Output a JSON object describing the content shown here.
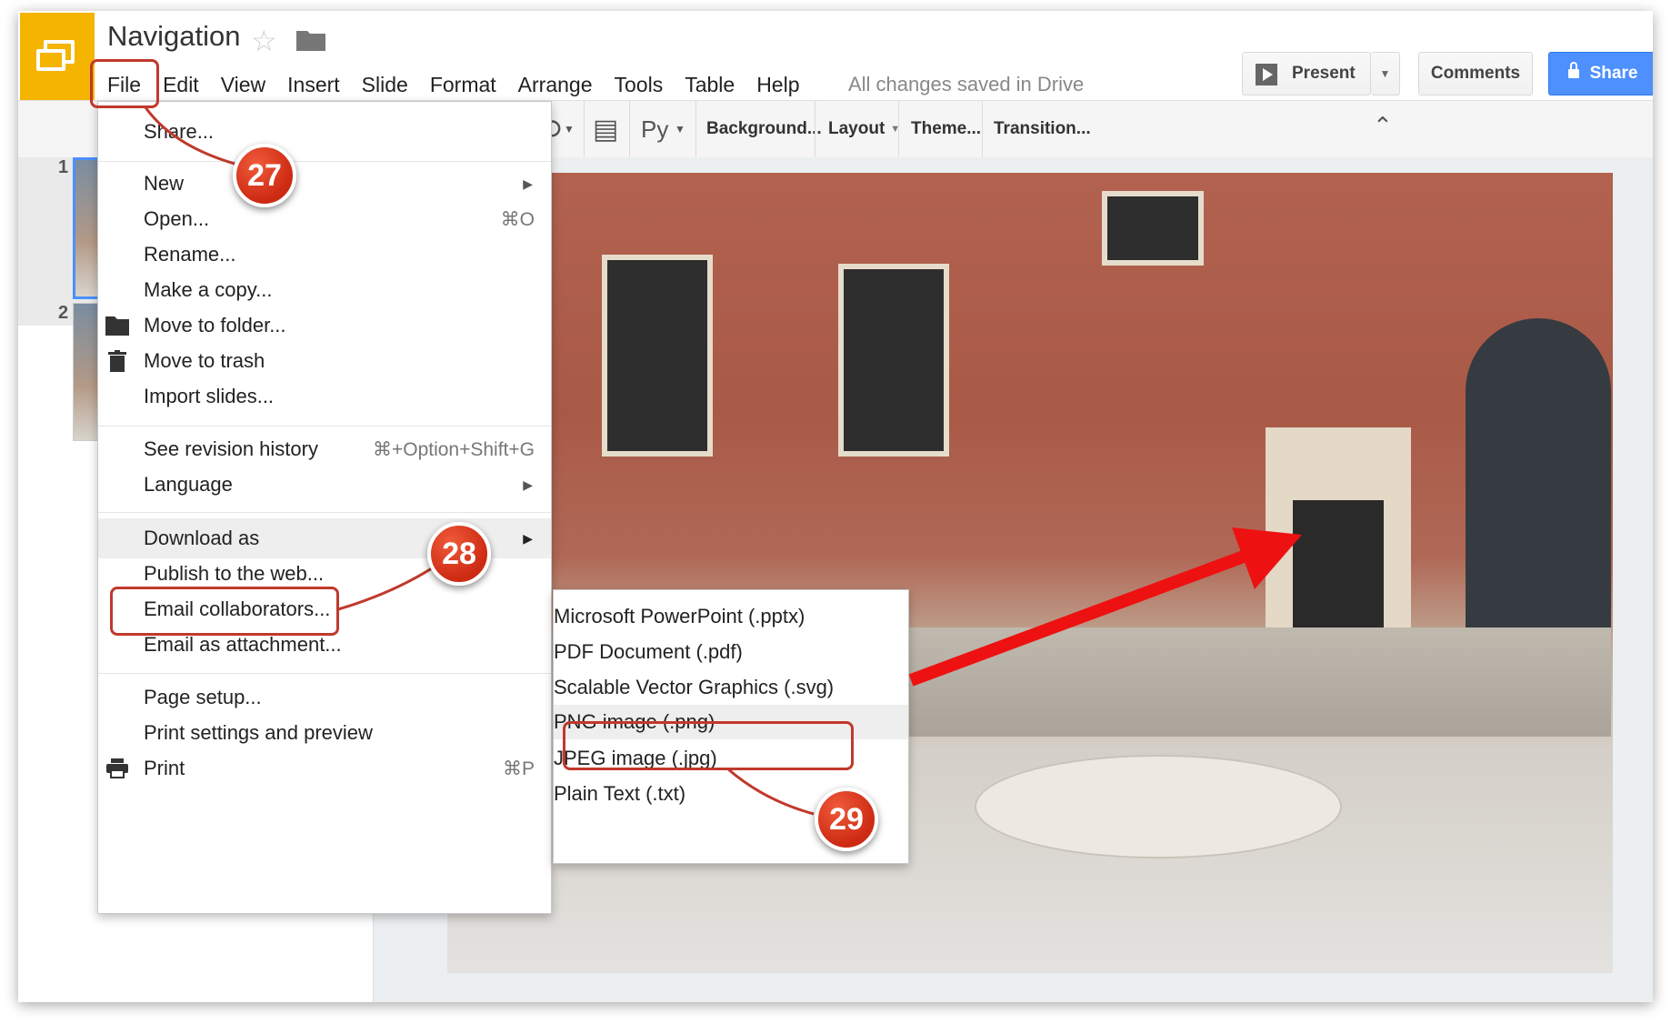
{
  "header": {
    "title": "Navigation",
    "save_status": "All changes saved in Drive",
    "present_label": "Present",
    "comments_label": "Comments",
    "share_label": "Share"
  },
  "menubar": [
    "File",
    "Edit",
    "View",
    "Insert",
    "Slide",
    "Format",
    "Arrange",
    "Tools",
    "Table",
    "Help"
  ],
  "toolbar": {
    "background_label": "Background...",
    "layout_label": "Layout",
    "theme_label": "Theme...",
    "transition_label": "Transition...",
    "font_icon_text": "Py"
  },
  "filmstrip": {
    "slide_numbers": [
      "1",
      "2"
    ]
  },
  "file_menu": {
    "share": "Share...",
    "new": "New",
    "open": "Open...",
    "open_shortcut": "⌘O",
    "rename": "Rename...",
    "make_copy": "Make a copy...",
    "move_to_folder": "Move to folder...",
    "move_to_trash": "Move to trash",
    "import_slides": "Import slides...",
    "revision_history": "See revision history",
    "revision_shortcut": "⌘+Option+Shift+G",
    "language": "Language",
    "download_as": "Download as",
    "publish": "Publish to the web...",
    "email_collab": "Email collaborators...",
    "email_attach": "Email as attachment...",
    "page_setup": "Page setup...",
    "print_settings": "Print settings and preview",
    "print": "Print",
    "print_shortcut": "⌘P"
  },
  "download_menu": [
    "Microsoft PowerPoint (.pptx)",
    "PDF Document (.pdf)",
    "Scalable Vector Graphics (.svg)",
    "PNG image (.png)",
    "JPEG image (.jpg)",
    "Plain Text (.txt)"
  ],
  "callouts": [
    "27",
    "28",
    "29"
  ],
  "colors": {
    "accent": "#4d90fe",
    "callout": "#cc2a12",
    "logo": "#f4b400"
  }
}
